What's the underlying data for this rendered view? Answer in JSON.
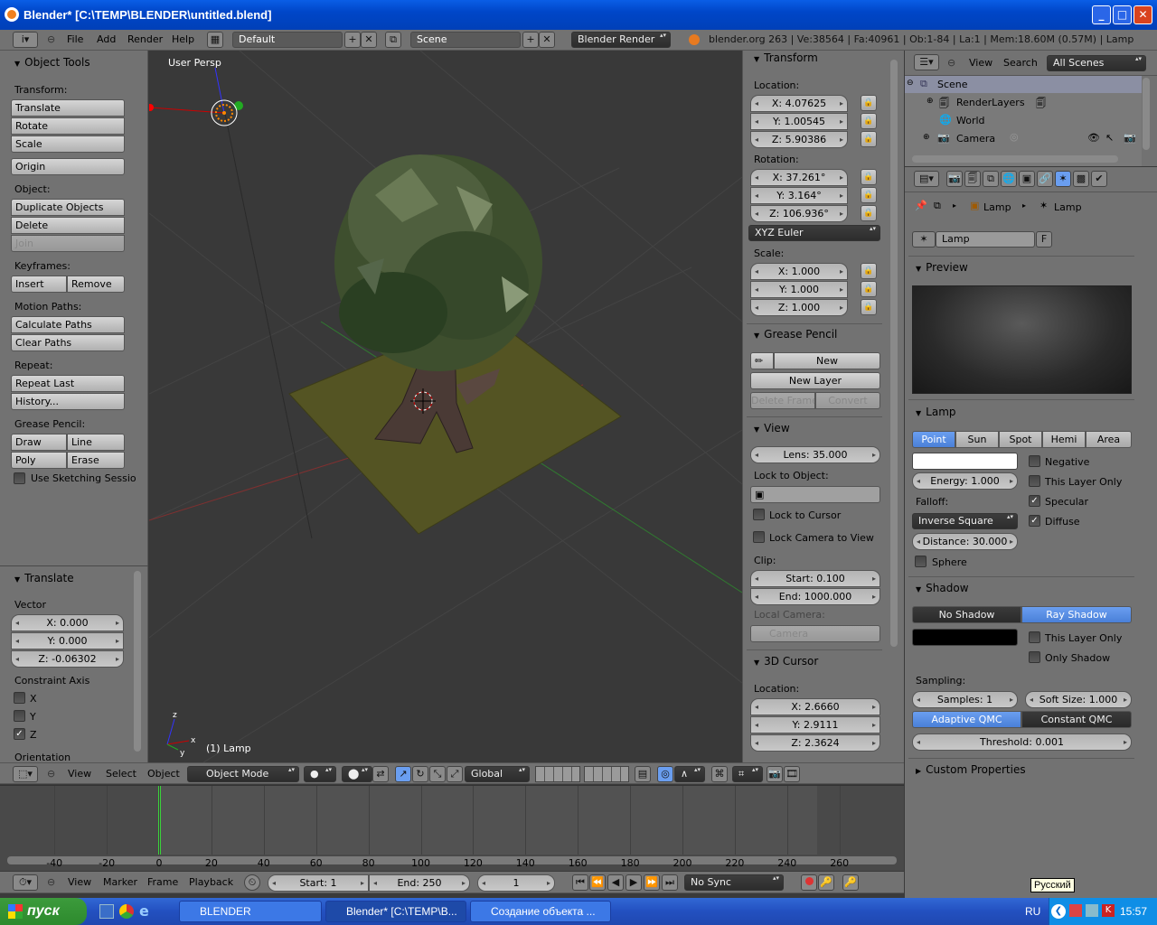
{
  "window": {
    "title": "Blender* [C:\\TEMP\\BLENDER\\untitled.blend]"
  },
  "info_header": {
    "menus": [
      "File",
      "Add",
      "Render",
      "Help"
    ],
    "layout": "Default",
    "scene": "Scene",
    "engine": "Blender Render",
    "stats": "blender.org 263 | Ve:38564 | Fa:40961 | Ob:1-84 | La:1 | Mem:18.60M (0.57M) | Lamp"
  },
  "tools": {
    "title": "Object Tools",
    "transform_label": "Transform:",
    "translate": "Translate",
    "rotate": "Rotate",
    "scale": "Scale",
    "origin": "Origin",
    "object_label": "Object:",
    "duplicate": "Duplicate Objects",
    "delete": "Delete",
    "join": "Join",
    "keyframes_label": "Keyframes:",
    "insert": "Insert",
    "remove": "Remove",
    "motion_label": "Motion Paths:",
    "calc_paths": "Calculate Paths",
    "clear_paths": "Clear Paths",
    "repeat_label": "Repeat:",
    "repeat_last": "Repeat Last",
    "history": "History...",
    "grease_label": "Grease Pencil:",
    "draw": "Draw",
    "line": "Line",
    "poly": "Poly",
    "erase": "Erase",
    "sketching": "Use Sketching Sessio"
  },
  "operator": {
    "title": "Translate",
    "vector_label": "Vector",
    "x": "X: 0.000",
    "y": "Y: 0.000",
    "z": "Z: -0.06302",
    "constraint_label": "Constraint Axis",
    "cx": "X",
    "cy": "Y",
    "cz": "Z",
    "orientation": "Orientation"
  },
  "viewport": {
    "view_name": "User Persp",
    "object_label": "(1) Lamp",
    "menus": [
      "View",
      "Select",
      "Object"
    ],
    "mode": "Object Mode",
    "orientation": "Global"
  },
  "properties_n": {
    "transform": "Transform",
    "location_label": "Location:",
    "loc_x": "X: 4.07625",
    "loc_y": "Y: 1.00545",
    "loc_z": "Z: 5.90386",
    "rotation_label": "Rotation:",
    "rot_x": "X: 37.261°",
    "rot_y": "Y: 3.164°",
    "rot_z": "Z: 106.936°",
    "rot_mode": "XYZ Euler",
    "scale_label": "Scale:",
    "sc_x": "X: 1.000",
    "sc_y": "Y: 1.000",
    "sc_z": "Z: 1.000",
    "grease": "Grease Pencil",
    "new": "New",
    "new_layer": "New Layer",
    "delete_frame": "Delete Frame",
    "convert": "Convert",
    "view": "View",
    "lens": "Lens: 35.000",
    "lock_obj": "Lock to Object:",
    "lock_cursor": "Lock to Cursor",
    "lock_cam": "Lock Camera to View",
    "clip_label": "Clip:",
    "clip_start": "Start: 0.100",
    "clip_end": "End: 1000.000",
    "local_cam": "Local Camera:",
    "camera": "Camera",
    "cursor": "3D Cursor",
    "cur_loc": "Location:",
    "cur_x": "X: 2.6660",
    "cur_y": "Y: 2.9111",
    "cur_z": "Z: 2.3624"
  },
  "outliner": {
    "menus": [
      "View",
      "Search"
    ],
    "filter": "All Scenes",
    "items": [
      "Scene",
      "RenderLayers",
      "World",
      "Camera"
    ]
  },
  "props": {
    "crumb1": "Lamp",
    "crumb2": "Lamp",
    "name": "Lamp",
    "fake": "F",
    "preview": "Preview",
    "lamp": "Lamp",
    "types": [
      "Point",
      "Sun",
      "Spot",
      "Hemi",
      "Area"
    ],
    "negative": "Negative",
    "this_layer": "This Layer Only",
    "specular": "Specular",
    "diffuse": "Diffuse",
    "energy": "Energy: 1.000",
    "falloff_label": "Falloff:",
    "falloff": "Inverse Square",
    "distance": "Distance: 30.000",
    "sphere": "Sphere",
    "shadow": "Shadow",
    "no_shadow": "No Shadow",
    "ray_shadow": "Ray Shadow",
    "sh_this_layer": "This Layer Only",
    "only_shadow": "Only Shadow",
    "sampling": "Sampling:",
    "samples": "Samples: 1",
    "soft_size": "Soft Size: 1.000",
    "adaptive": "Adaptive QMC",
    "constant": "Constant QMC",
    "threshold": "Threshold: 0.001",
    "custom": "Custom Properties",
    "tooltip": "Русский"
  },
  "timeline": {
    "ticks": [
      "-40",
      "-20",
      "0",
      "20",
      "40",
      "60",
      "80",
      "100",
      "120",
      "140",
      "160",
      "180",
      "200",
      "220",
      "240",
      "260"
    ],
    "menus": [
      "View",
      "Marker",
      "Frame",
      "Playback"
    ],
    "start": "Start: 1",
    "end": "End: 250",
    "current": "1",
    "sync": "No Sync"
  },
  "taskbar": {
    "start": "пуск",
    "tasks": [
      "BLENDER",
      "Blender* [C:\\TEMP\\B...",
      "Создание объекта ..."
    ],
    "lang": "RU",
    "clock": "15:57"
  },
  "colors": {
    "title_blue": "#0a5ee6",
    "panel": "#727272",
    "viewport": "#393939",
    "accent": "#5a8ee0",
    "plane": "#545423"
  }
}
